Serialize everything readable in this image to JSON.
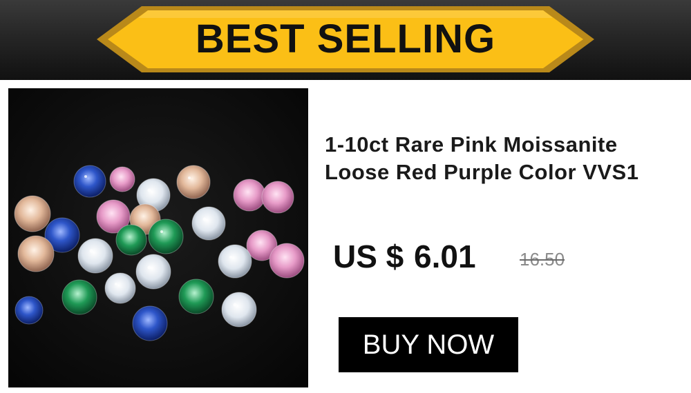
{
  "banner": {
    "title": "BEST SELLING",
    "ribbon_color": "#fbbf16",
    "ribbon_edge_color": "#c9961a",
    "background_color": "#262626"
  },
  "product": {
    "image_description_icon": "colored-gemstones-photo",
    "title_line1": "1-10ct Rare Pink Moissanite",
    "title_line2": "Loose Red Purple Color VVS1",
    "currency": "US $",
    "price": "6.01",
    "original_price": "16.50"
  },
  "button": {
    "label": "BUY NOW",
    "background_color": "#000000",
    "text_color": "#ffffff"
  },
  "gem_colors": {
    "blue": "#2e56c9",
    "pink": "#e79bc8",
    "champagne": "#e2b89a",
    "white": "#e9eef5",
    "green": "#1f9a56"
  }
}
